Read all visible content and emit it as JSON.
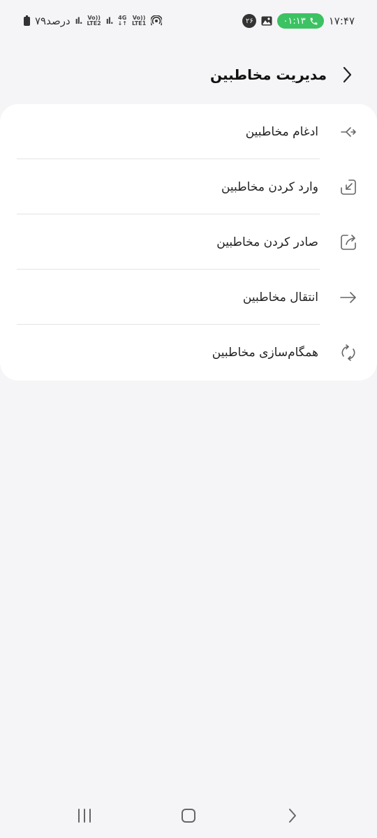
{
  "status_bar": {
    "time": "۱۷:۴۷",
    "call_duration": "۰۱:۱۳",
    "notification_count": "۲۶",
    "battery_text": "۷۹درصد",
    "sim2_label_top": "Vo))",
    "sim2_label_bottom": "LTE2",
    "network_label_top": "4G",
    "sim1_label_top": "Vo))",
    "sim1_label_bottom": "LTE1",
    "icons": [
      "hotspot-icon",
      "signal-icon",
      "battery-icon",
      "phone-icon",
      "gallery-icon"
    ]
  },
  "header": {
    "title": "مدیریت مخاطبین",
    "back_icon": "chevron-left-icon"
  },
  "menu": {
    "items": [
      {
        "label": "ادغام مخاطبین",
        "icon": "merge-icon"
      },
      {
        "label": "وارد کردن مخاطبین",
        "icon": "import-icon"
      },
      {
        "label": "صادر کردن مخاطبین",
        "icon": "export-icon"
      },
      {
        "label": "انتقال مخاطبین",
        "icon": "arrow-right-icon"
      },
      {
        "label": "همگام‌سازی مخاطبین",
        "icon": "sync-icon"
      }
    ]
  },
  "nav_bar": {
    "icons": [
      "recent-apps-icon",
      "home-icon",
      "back-icon"
    ]
  },
  "colors": {
    "background": "#f5f5f7",
    "card": "#ffffff",
    "call_pill": "#3cc262",
    "icon_stroke": "#666666"
  }
}
